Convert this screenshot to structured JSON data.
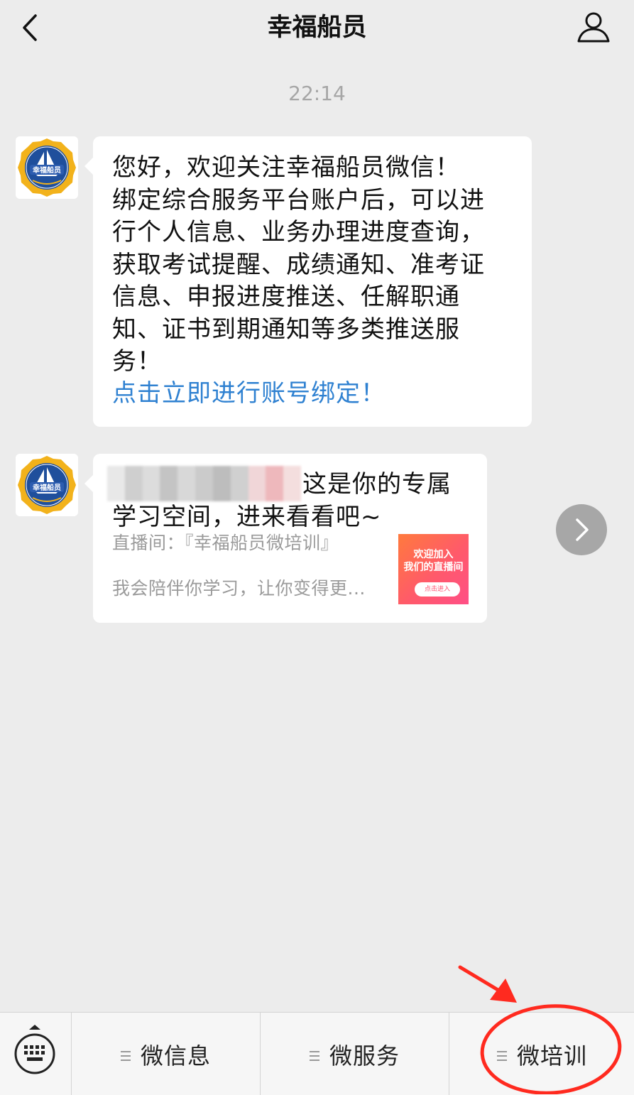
{
  "header": {
    "title": "幸福船员"
  },
  "timestamp": "22:14",
  "messages": [
    {
      "text": "您好，欢迎关注幸福船员微信！\n绑定综合服务平台账户后，可以进\n行个人信息、业务办理进度查询，\n获取考试提醒、成绩通知、准考证\n信息、申报进度推送、任解职通\n知、证书到期通知等多类推送服\n务！",
      "link": "点击立即进行账号绑定！"
    }
  ],
  "card": {
    "title_line1": "这是你的专属",
    "title_line2": "学习空间，进来看看吧~",
    "subtitle": "直播间：『幸福船员微培训』",
    "description": "我会陪伴你学习，让你变得更...",
    "thumbnail": {
      "line1": "欢迎加入",
      "line2": "我们的直播间",
      "button": "点击进入"
    }
  },
  "avatar": {
    "ring_text": "HAPPY SEAFARER",
    "center_text": "幸福船员"
  },
  "menu": [
    {
      "label": "微信息"
    },
    {
      "label": "微服务"
    },
    {
      "label": "微培训"
    }
  ],
  "colors": {
    "background": "#ececec",
    "link": "#2f81d1",
    "annotation": "#ff2a1f",
    "bubble": "#ffffff"
  },
  "icons": {
    "back": "chevron-left-icon",
    "profile": "person-icon",
    "share": "chevron-right-icon",
    "keyboard": "keyboard-icon",
    "menu": "menu-lines-icon"
  }
}
